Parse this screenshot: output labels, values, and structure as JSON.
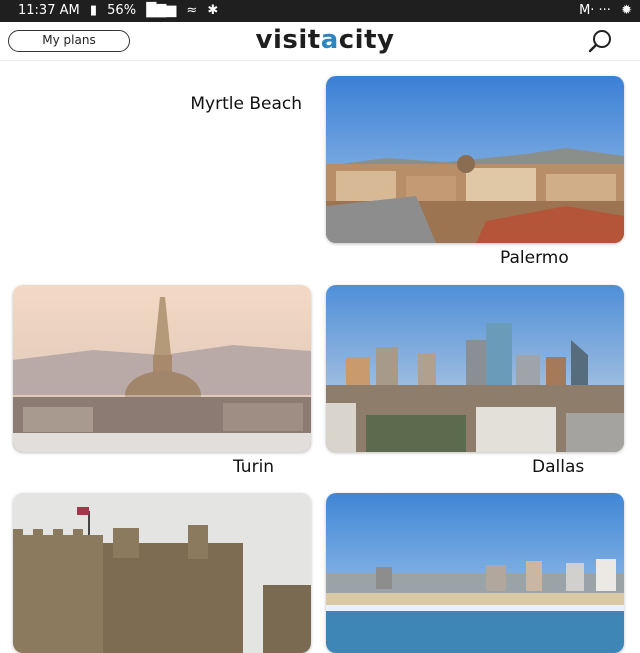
{
  "status_bar": {
    "time": "11:37 AM",
    "battery": "56%",
    "indicators": "M· ···"
  },
  "header": {
    "logo_part1": "visit",
    "logo_accent": "a",
    "logo_part2": "city",
    "my_plans_label": "My plans",
    "accent_color": "#2e86c1"
  },
  "headline": "Myrtle Beach",
  "cities": [
    {
      "name": "Palermo"
    },
    {
      "name": "Dallas"
    },
    {
      "name": "Turin"
    }
  ],
  "icons": [
    "search-icon",
    "wifi-icon",
    "signal-icon",
    "battery-icon",
    "bluetooth-icon",
    "fan-icon"
  ]
}
